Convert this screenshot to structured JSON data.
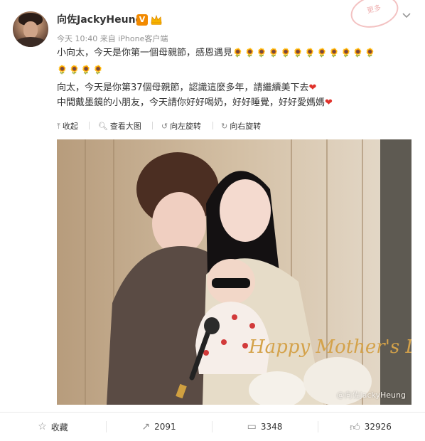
{
  "user": {
    "name": "向佐JackyHeung",
    "badge": "V",
    "time": "今天 10:40",
    "source_prefix": "来自",
    "source": "iPhone客户端"
  },
  "stamp_text": "更多",
  "post": {
    "line1": "小向太，今天是你第一個母親節，感恩遇見",
    "line1_emojis": "🌻🌻🌻🌻🌻🌻🌻🌻🌻🌻🌻🌻",
    "line2_emojis": "🌻🌻🌻🌻",
    "line3": "向太，今天是你第37個母親節，認識這麼多年，請繼續美下去",
    "line4": "中間戴墨鏡的小朋友，今天請你好好喝奶，好好睡覺，好好愛媽媽",
    "heart": "❤"
  },
  "toolbar": {
    "collapse": "收起",
    "view_large": "查看大图",
    "rotate_left": "向左旋转",
    "rotate_right": "向右旋转"
  },
  "image": {
    "watermark": "@向佐JackyHeung",
    "sign_text": "Happy Mother's Day"
  },
  "actions": {
    "favorite": "收藏",
    "repost": "2091",
    "comment": "3348",
    "like": "32926"
  },
  "colors": {
    "accent": "#f28a00",
    "heart": "#e0322b",
    "meta": "#939393"
  }
}
